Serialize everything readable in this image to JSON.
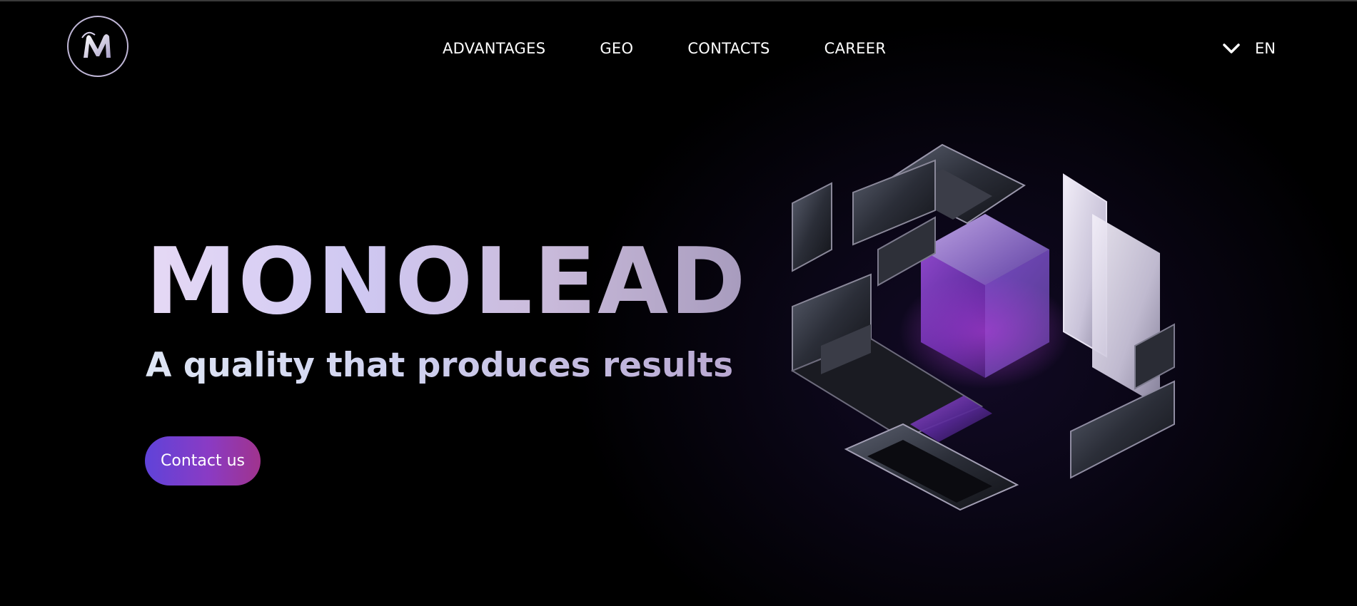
{
  "header": {
    "nav": [
      {
        "label": "ADVANTAGES"
      },
      {
        "label": "GEO"
      },
      {
        "label": "CONTACTS"
      },
      {
        "label": "CAREER"
      }
    ],
    "language": {
      "current": "EN",
      "icon": "chevron-down-icon"
    },
    "logo": {
      "icon": "monolead-logo"
    }
  },
  "hero": {
    "title": "MONOLEAD",
    "subtitle": "A quality that produces results",
    "cta_label": "Contact us"
  },
  "colors": {
    "background": "#000000",
    "accent_start": "#5f43d9",
    "accent_end": "#a0338d",
    "title_gradient_light": "#e6d9f5",
    "title_gradient_dark": "#a79bbd"
  }
}
